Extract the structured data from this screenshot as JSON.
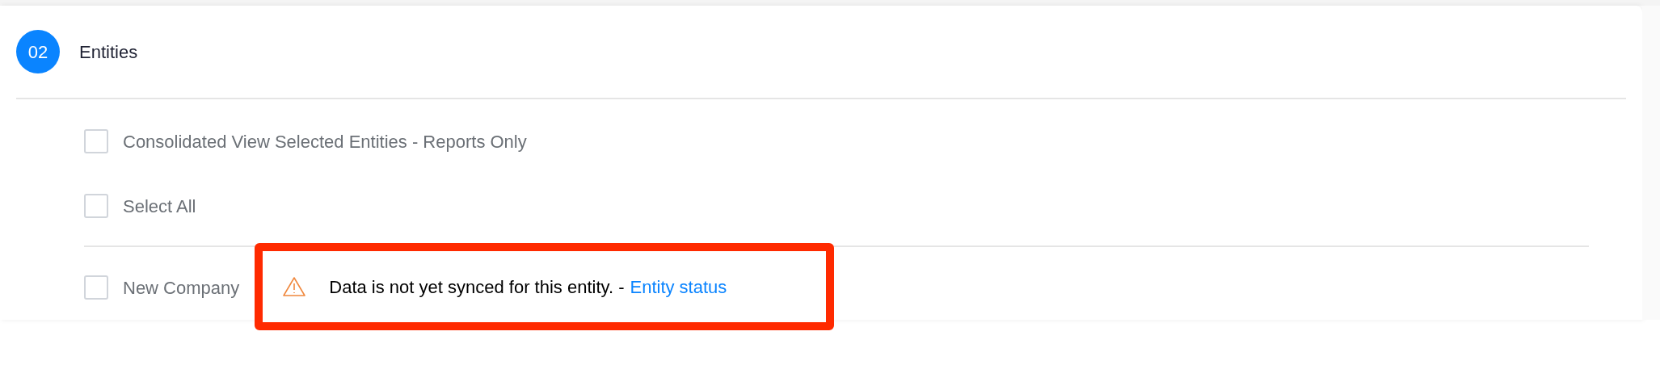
{
  "section": {
    "step": "02",
    "title": "Entities"
  },
  "options": [
    {
      "label": "Consolidated View Selected Entities - Reports Only",
      "checked": false
    },
    {
      "label": "Select All",
      "checked": false
    }
  ],
  "entities": [
    {
      "label": "New Company",
      "checked": false,
      "warning": {
        "text": "Data is not yet synced for this entity. -",
        "link": "Entity status"
      }
    }
  ]
}
